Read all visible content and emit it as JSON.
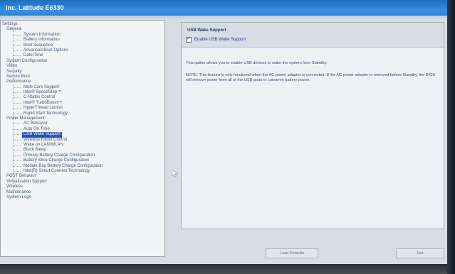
{
  "window": {
    "title": "Inc. Latitude E6330"
  },
  "tree": {
    "items": [
      {
        "label": "Settings",
        "level": 0,
        "selected": false
      },
      {
        "label": "General",
        "level": 1,
        "selected": false
      },
      {
        "label": "System Information",
        "level": 2,
        "selected": false
      },
      {
        "label": "Battery Information",
        "level": 2,
        "selected": false
      },
      {
        "label": "Boot Sequence",
        "level": 2,
        "selected": false
      },
      {
        "label": "Advanced Boot Options",
        "level": 2,
        "selected": false
      },
      {
        "label": "Date/Time",
        "level": 2,
        "selected": false
      },
      {
        "label": "System Configuration",
        "level": 1,
        "selected": false
      },
      {
        "label": "Video",
        "level": 1,
        "selected": false
      },
      {
        "label": "Security",
        "level": 1,
        "selected": false
      },
      {
        "label": "Secure Boot",
        "level": 1,
        "selected": false
      },
      {
        "label": "Performance",
        "level": 1,
        "selected": false
      },
      {
        "label": "Multi Core Support",
        "level": 2,
        "selected": false
      },
      {
        "label": "Intel® SpeedStep™",
        "level": 2,
        "selected": false
      },
      {
        "label": "C-States Control",
        "level": 2,
        "selected": false
      },
      {
        "label": "Intel® TurboBoost™",
        "level": 2,
        "selected": false
      },
      {
        "label": "HyperThread control",
        "level": 2,
        "selected": false
      },
      {
        "label": "Rapid Start Technology",
        "level": 2,
        "selected": false
      },
      {
        "label": "Power Management",
        "level": 1,
        "selected": false
      },
      {
        "label": "AC Behavior",
        "level": 2,
        "selected": false
      },
      {
        "label": "Auto On Time",
        "level": 2,
        "selected": false
      },
      {
        "label": "USB Wake Support",
        "level": 2,
        "selected": true
      },
      {
        "label": "Wireless Radio Control",
        "level": 2,
        "selected": false
      },
      {
        "label": "Wake on LAN/WLAN",
        "level": 2,
        "selected": false
      },
      {
        "label": "Block Sleep",
        "level": 2,
        "selected": false
      },
      {
        "label": "Primary Battery Charge Configuration",
        "level": 2,
        "selected": false
      },
      {
        "label": "Battery Slice Charge Configuration",
        "level": 2,
        "selected": false
      },
      {
        "label": "Module Bay Battery Charge Configuration",
        "level": 2,
        "selected": false
      },
      {
        "label": "Intel(R) Smart Connect Technology",
        "level": 2,
        "selected": false
      },
      {
        "label": "POST Behavior",
        "level": 1,
        "selected": false
      },
      {
        "label": "Virtualization Support",
        "level": 1,
        "selected": false
      },
      {
        "label": "Wireless",
        "level": 1,
        "selected": false
      },
      {
        "label": "Maintenance",
        "level": 1,
        "selected": false
      },
      {
        "label": "System Logs",
        "level": 1,
        "selected": false
      }
    ]
  },
  "detail": {
    "title": "USB Wake Support",
    "checkbox_label": "Enable USB Wake Support",
    "checkbox_checked": true,
    "paragraphs": [
      "This option allows you to enable USB devices to wake the system from Standby.",
      "NOTE: This feature is only functional when the AC power adapter is connected. If the AC power adapter is removed before Standby, the BIOS will remove power from all of the USB ports to conserve battery power."
    ]
  },
  "buttons": {
    "load_defaults": "Load Defaults",
    "exit": "Exit"
  }
}
